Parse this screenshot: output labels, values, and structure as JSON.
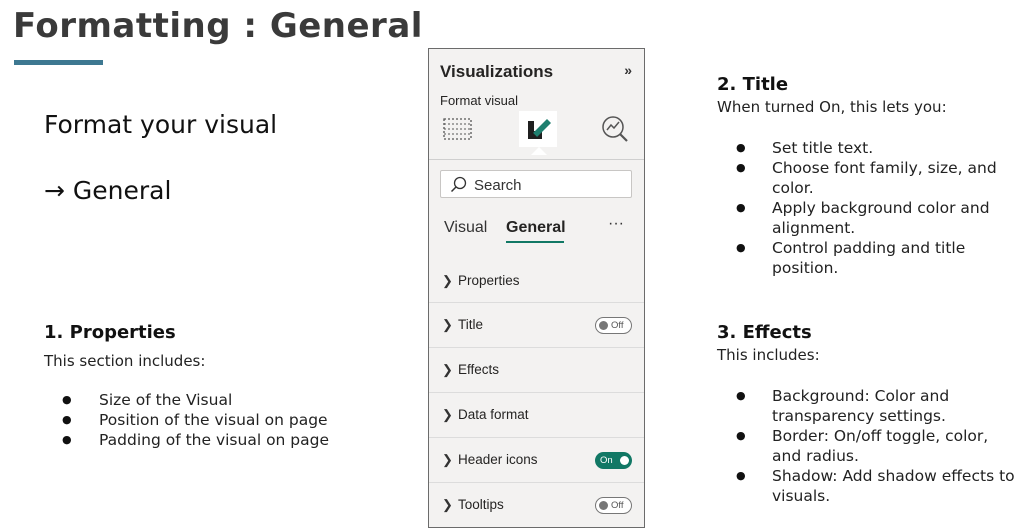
{
  "slide": {
    "title": "Formatting : General",
    "subtitle1": "Format your visual",
    "subtitle2": "→ General"
  },
  "properties": {
    "heading": "1. Properties",
    "intro": "This section includes:",
    "items": [
      "Size of the Visual",
      "Position of the visual on page",
      "Padding of the visual on page"
    ]
  },
  "title_section": {
    "heading": "2. Title",
    "intro": "When turned On, this lets you:",
    "items": [
      "Set title text.",
      "Choose font family, size, and color.",
      "Apply background color and alignment.",
      "Control padding and title position."
    ]
  },
  "effects_section": {
    "heading": "3. Effects",
    "intro": "This includes:",
    "items": [
      "Background: Color and transparency settings.",
      "Border: On/off toggle, color, and radius.",
      "Shadow: Add shadow effects to visuals."
    ]
  },
  "panel": {
    "header": "Visualizations",
    "collapse_glyph": "»",
    "format_label": "Format visual",
    "icons": [
      "build-visual-icon",
      "format-visual-icon",
      "analytics-icon"
    ],
    "search_placeholder": "Search",
    "tabs": [
      "Visual",
      "General"
    ],
    "active_tab": "General",
    "more_glyph": "···",
    "sections": [
      {
        "label": "Properties",
        "toggle": null
      },
      {
        "label": "Title",
        "toggle": "Off"
      },
      {
        "label": "Effects",
        "toggle": null
      },
      {
        "label": "Data format",
        "toggle": null
      },
      {
        "label": "Header icons",
        "toggle": "On"
      },
      {
        "label": "Tooltips",
        "toggle": "Off"
      }
    ]
  },
  "colors": {
    "accent": "#3d7891",
    "toggle_on": "#117865"
  }
}
